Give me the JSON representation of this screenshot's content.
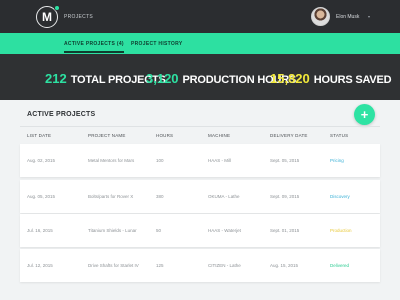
{
  "header": {
    "logo_letter": "M",
    "nav_label": "Projects",
    "user_name": "Elon Musk",
    "user_caret": "▾"
  },
  "tabs": [
    {
      "label": "Active Projects (4)",
      "active": true
    },
    {
      "label": "Project History",
      "active": false
    }
  ],
  "stats": [
    {
      "value": "212",
      "label": "Total Projects",
      "color": "#2de1a2"
    },
    {
      "value": "3,120",
      "label": "Production Hours",
      "color": "#2de1a2"
    },
    {
      "value": "15,820",
      "label": "Hours Saved",
      "color": "#f2e93a"
    }
  ],
  "section": {
    "title": "Active Projects",
    "add_button": "+"
  },
  "columns": [
    "List Date",
    "Project Name",
    "Hours",
    "Machine",
    "Delivery Date",
    "Status"
  ],
  "rows": [
    {
      "list_date": "Aug. 02, 2015",
      "name": "Metal Mentors for Mars",
      "hours": "100",
      "machine": "HAAS - Mill",
      "delivery": "Sept. 05, 2015",
      "status": "Pricing",
      "status_color": "#3ab0d6"
    },
    {
      "list_date": "Aug. 05, 2015",
      "name": "Bolts/parts for Rover X",
      "hours": "380",
      "machine": "OKUMA - Lathe",
      "delivery": "Sept. 09, 2015",
      "status": "Discovery",
      "status_color": "#3ab0d6"
    },
    {
      "list_date": "Jul. 16, 2015",
      "name": "Titanium Shields - Lunar",
      "hours": "50",
      "machine": "HAAS - Waterjet",
      "delivery": "Sept. 01, 2015",
      "status": "Production",
      "status_color": "#e8c93a"
    },
    {
      "list_date": "Jul. 12, 2015",
      "name": "Drive Shafts for Starlet IV",
      "hours": "125",
      "machine": "CITIZEN - Lathe",
      "delivery": "Aug. 15, 2015",
      "status": "Delivered",
      "status_color": "#2dcc92"
    }
  ]
}
